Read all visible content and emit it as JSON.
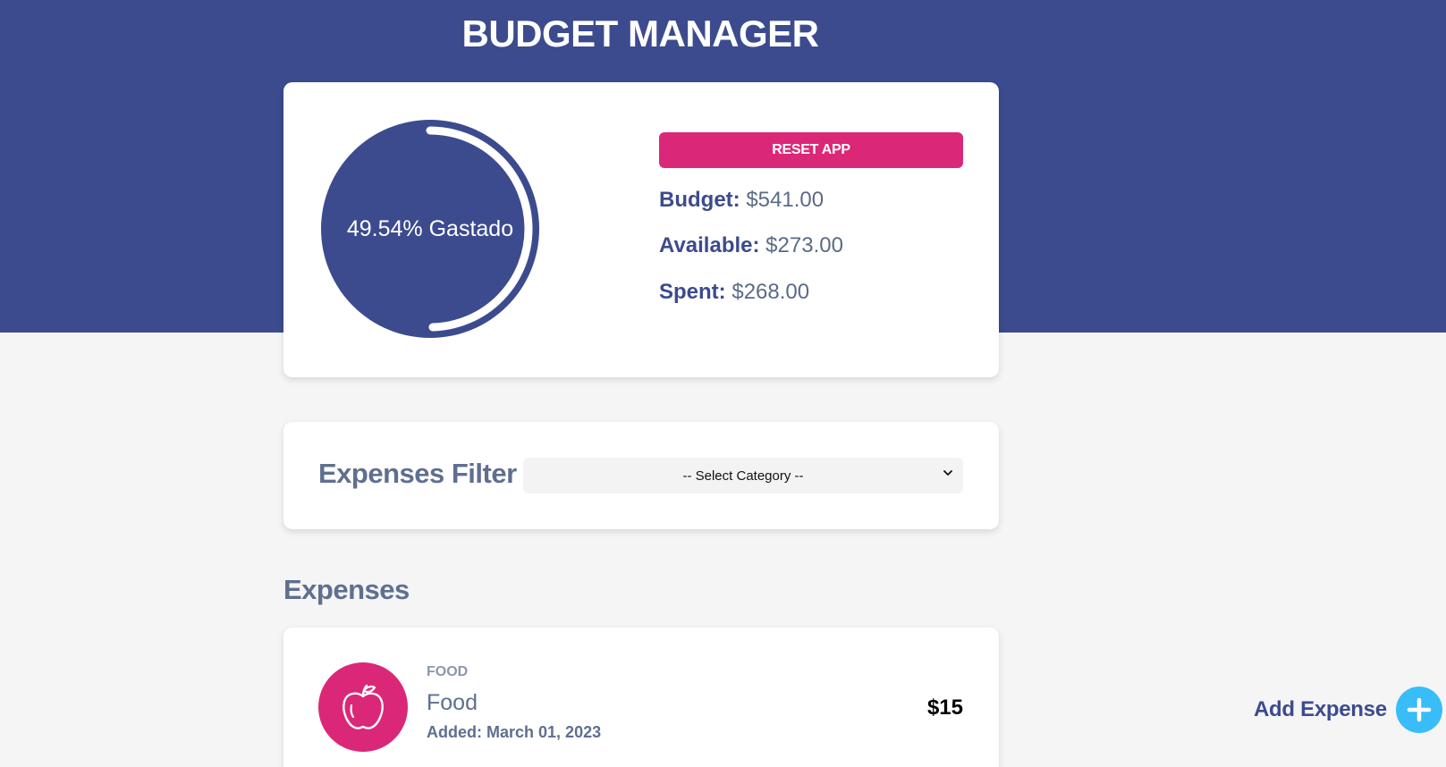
{
  "header": {
    "title": "BUDGET MANAGER",
    "bg_color": "#3c4b8e"
  },
  "budget_card": {
    "progress": {
      "percent": 49.54,
      "label": "49.54% Gastado"
    },
    "reset_label": "RESET APP",
    "stats": {
      "budget_label": "Budget:",
      "budget_value": "$541.00",
      "available_label": "Available:",
      "available_value": "$273.00",
      "spent_label": "Spent:",
      "spent_value": "$268.00"
    }
  },
  "filter": {
    "label": "Expenses Filter",
    "select_value": "-- Select Category --"
  },
  "expenses": {
    "heading": "Expenses",
    "items": [
      {
        "category": "FOOD",
        "name": "Food",
        "date_label": "Added:",
        "date_value": "March 01, 2023",
        "amount": "$15",
        "icon": "apple-icon"
      }
    ]
  },
  "add_expense": {
    "label": "Add Expense",
    "icon": "plus-icon"
  },
  "colors": {
    "primary": "#3c4b8e",
    "accent": "#db2777",
    "add_button": "#38bdf8"
  }
}
